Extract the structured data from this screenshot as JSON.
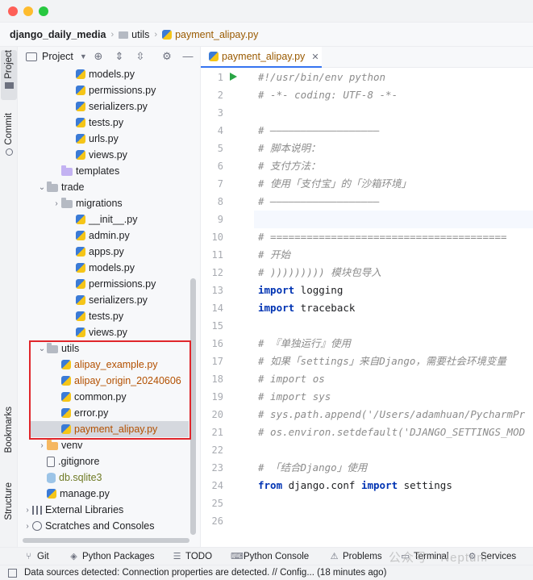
{
  "window": {
    "traffic_lights": [
      "close",
      "minimize",
      "zoom"
    ]
  },
  "breadcrumb": {
    "root": "django_daily_media",
    "folder": "utils",
    "file": "payment_alipay.py"
  },
  "left_strip": {
    "project": "Project",
    "commit": "Commit",
    "bookmarks": "Bookmarks",
    "structure": "Structure"
  },
  "project_panel": {
    "title": "Project",
    "tree": [
      {
        "label": "models.py",
        "type": "py",
        "color": "default"
      },
      {
        "label": "permissions.py",
        "type": "py",
        "color": "default"
      },
      {
        "label": "serializers.py",
        "type": "py",
        "color": "default"
      },
      {
        "label": "tests.py",
        "type": "py",
        "color": "default"
      },
      {
        "label": "urls.py",
        "type": "py",
        "color": "default"
      },
      {
        "label": "views.py",
        "type": "py",
        "color": "default"
      },
      {
        "label": "templates",
        "type": "folder-purple",
        "color": "default"
      },
      {
        "label": "trade",
        "type": "folder",
        "color": "default",
        "expanded": true
      },
      {
        "label": "migrations",
        "type": "folder",
        "color": "default",
        "expanded": false
      },
      {
        "label": "__init__.py",
        "type": "py",
        "color": "default"
      },
      {
        "label": "admin.py",
        "type": "py",
        "color": "default"
      },
      {
        "label": "apps.py",
        "type": "py",
        "color": "default"
      },
      {
        "label": "models.py",
        "type": "py",
        "color": "default"
      },
      {
        "label": "permissions.py",
        "type": "py",
        "color": "default"
      },
      {
        "label": "serializers.py",
        "type": "py",
        "color": "default"
      },
      {
        "label": "tests.py",
        "type": "py",
        "color": "default"
      },
      {
        "label": "views.py",
        "type": "py",
        "color": "default"
      },
      {
        "label": "utils",
        "type": "folder",
        "color": "default",
        "expanded": true
      },
      {
        "label": "alipay_example.py",
        "type": "py",
        "color": "#b35000"
      },
      {
        "label": "alipay_origin_20240606",
        "type": "py",
        "color": "#b35000"
      },
      {
        "label": "common.py",
        "type": "py",
        "color": "default"
      },
      {
        "label": "error.py",
        "type": "py",
        "color": "default"
      },
      {
        "label": "payment_alipay.py",
        "type": "py",
        "color": "#b35000",
        "selected": true
      },
      {
        "label": "venv",
        "type": "folder-orange",
        "color": "default",
        "expanded": false
      },
      {
        "label": ".gitignore",
        "type": "git",
        "color": "default"
      },
      {
        "label": "db.sqlite3",
        "type": "db",
        "color": "#6f7a24"
      },
      {
        "label": "manage.py",
        "type": "py",
        "color": "default"
      },
      {
        "label": "External Libraries",
        "type": "lib",
        "color": "default",
        "expanded": false
      },
      {
        "label": "Scratches and Consoles",
        "type": "scratch",
        "color": "default",
        "expanded": false
      }
    ]
  },
  "editor": {
    "tab_label": "payment_alipay.py",
    "current_line": 9,
    "lines": [
      [
        [
          "cm",
          "#!/usr/bin/env python"
        ]
      ],
      [
        [
          "cm",
          "# -*- coding: UTF-8 -*-"
        ]
      ],
      [],
      [
        [
          "cm",
          "# ——————————————————"
        ]
      ],
      [
        [
          "cm",
          "# 脚本说明："
        ]
      ],
      [
        [
          "cm",
          "# 支付方法："
        ]
      ],
      [
        [
          "cm",
          "# 使用「支付宝」的「沙箱环境」"
        ]
      ],
      [
        [
          "cm",
          "# ——————————————————"
        ]
      ],
      [],
      [
        [
          "cm",
          "# ======================================="
        ]
      ],
      [
        [
          "cm",
          "# 开始"
        ]
      ],
      [
        [
          "cm",
          "# ))))))))) 模块包导入"
        ]
      ],
      [
        [
          "kw",
          "import"
        ],
        [
          "pl",
          " logging"
        ]
      ],
      [
        [
          "kw",
          "import"
        ],
        [
          "pl",
          " traceback"
        ]
      ],
      [],
      [
        [
          "cm",
          "# 『单独运行』使用"
        ]
      ],
      [
        [
          "cm",
          "# 如果「settings」来自Django，需要社会环境变量"
        ]
      ],
      [
        [
          "cm",
          "# import os"
        ]
      ],
      [
        [
          "cm",
          "# import sys"
        ]
      ],
      [
        [
          "cm",
          "# sys.path.append('/Users/adamhuan/PycharmPr"
        ]
      ],
      [
        [
          "cm",
          "# os.environ.setdefault('DJANGO_SETTINGS_MOD"
        ]
      ],
      [],
      [
        [
          "cm",
          "# 「结合Django」使用"
        ]
      ],
      [
        [
          "kw",
          "from"
        ],
        [
          "pl",
          " django.conf "
        ],
        [
          "kw",
          "import"
        ],
        [
          "pl",
          " settings"
        ]
      ],
      [],
      []
    ]
  },
  "bottom_tools": [
    {
      "label": "Git",
      "icon": "branch-icon"
    },
    {
      "label": "Python Packages",
      "icon": "layers-icon"
    },
    {
      "label": "TODO",
      "icon": "list-icon"
    },
    {
      "label": "Python Console",
      "icon": "python-icon"
    },
    {
      "label": "Problems",
      "icon": "warning-icon"
    },
    {
      "label": "Terminal",
      "icon": "terminal-icon"
    },
    {
      "label": "Services",
      "icon": "services-icon"
    }
  ],
  "watermark": "公众号 · Neptuni",
  "status": {
    "message": "Data sources detected: Connection properties are detected. // Config... (18 minutes ago)"
  }
}
